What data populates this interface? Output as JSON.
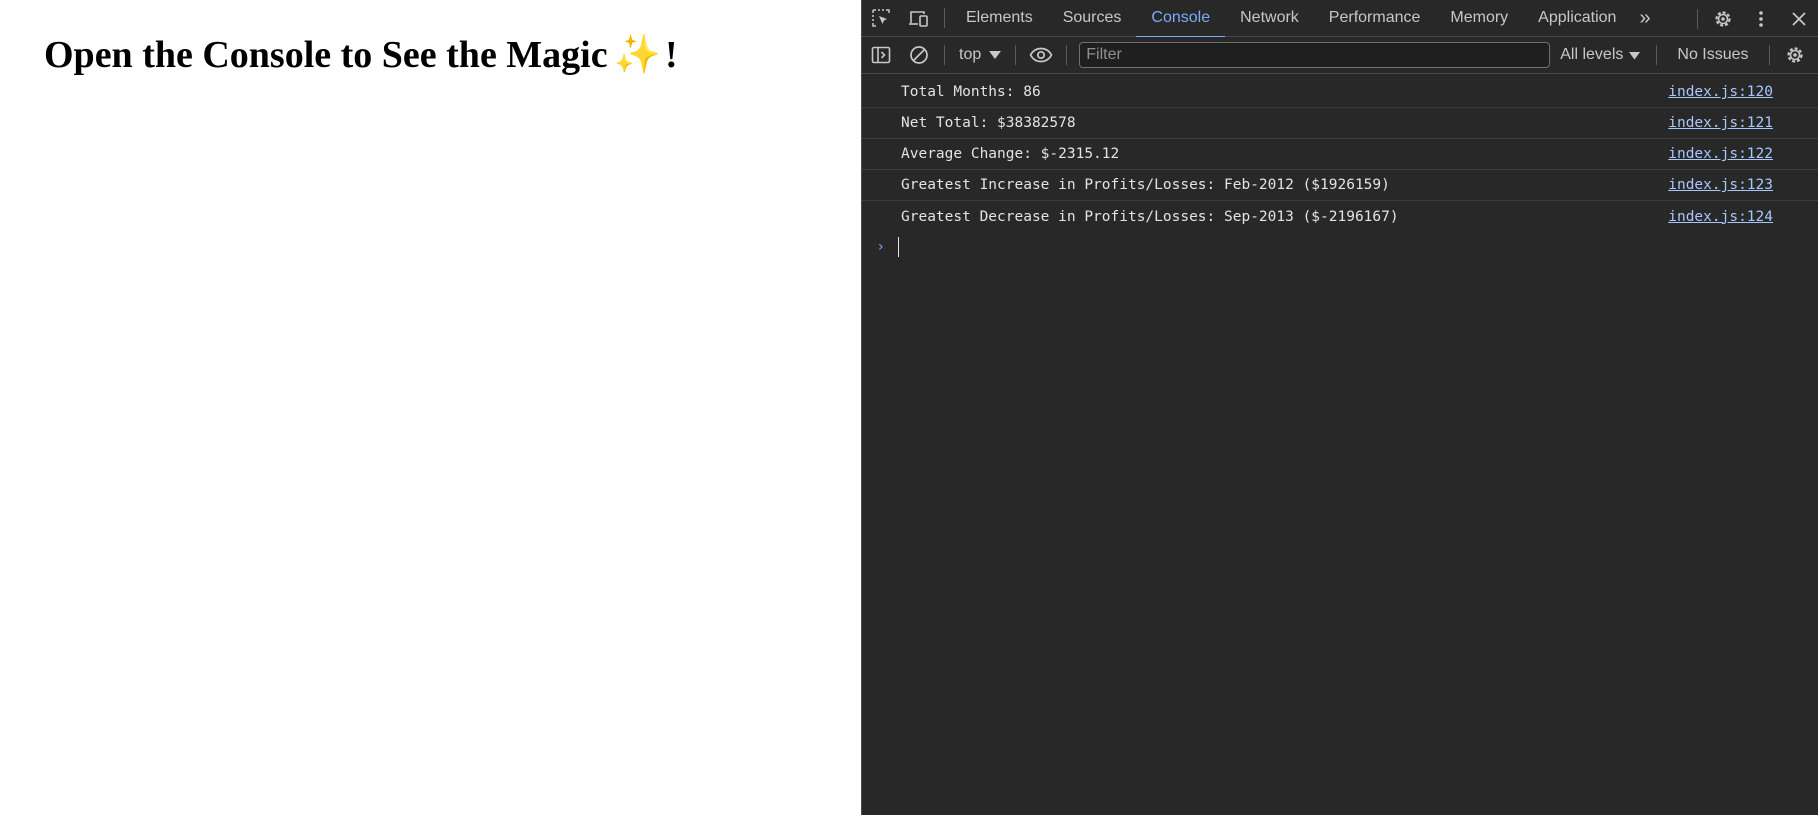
{
  "page": {
    "heading_text": "Open the Console to See the Magic",
    "heading_emoji": "✨",
    "heading_suffix": "!"
  },
  "devtools": {
    "tabs": [
      {
        "label": "Elements",
        "active": false
      },
      {
        "label": "Sources",
        "active": false
      },
      {
        "label": "Console",
        "active": true
      },
      {
        "label": "Network",
        "active": false
      },
      {
        "label": "Performance",
        "active": false
      },
      {
        "label": "Memory",
        "active": false
      },
      {
        "label": "Application",
        "active": false
      }
    ],
    "more_tabs_glyph": "»",
    "toolbar": {
      "context": "top",
      "filter_placeholder": "Filter",
      "levels": "All levels",
      "issues": "No Issues"
    },
    "messages": [
      {
        "text": "Total Months: 86",
        "source": "index.js:120"
      },
      {
        "text": "Net Total: $38382578",
        "source": "index.js:121"
      },
      {
        "text": "Average Change: $-2315.12",
        "source": "index.js:122"
      },
      {
        "text": "Greatest Increase in Profits/Losses: Feb-2012 ($1926159)",
        "source": "index.js:123"
      },
      {
        "text": "Greatest Decrease in Profits/Losses: Sep-2013 ($-2196167)",
        "source": "index.js:124"
      }
    ],
    "colors": {
      "background": "#282828",
      "accent": "#7cacf8",
      "link": "#a8c7fa",
      "text": "#e3e3e3"
    }
  }
}
